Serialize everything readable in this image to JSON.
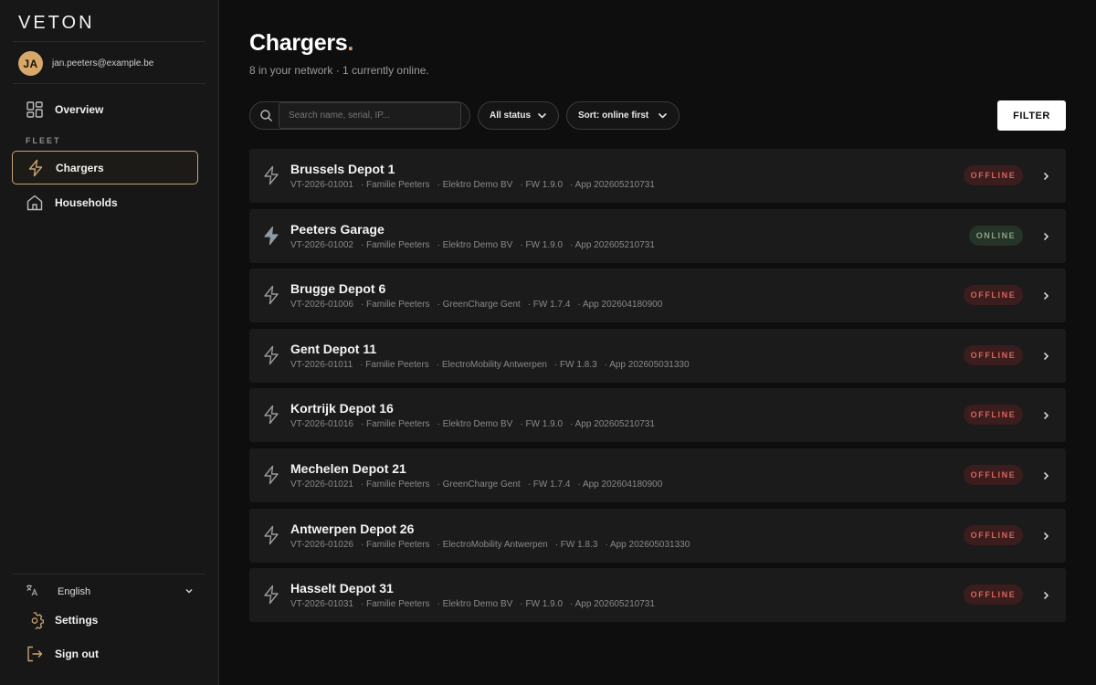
{
  "app": {
    "logo": "VETON"
  },
  "user": {
    "initials": "JA",
    "email": "jan.peeters@example.be"
  },
  "sidebar": {
    "overview_label": "Overview",
    "section_label": "FLEET",
    "chargers_label": "Chargers",
    "households_label": "Households",
    "language": "English",
    "settings_label": "Settings",
    "signout_label": "Sign out"
  },
  "page": {
    "title": "Chargers",
    "title_dot": ".",
    "subtitle": "8 in your network · 1 currently online."
  },
  "toolbar": {
    "search_placeholder": "Search name, serial, IP...",
    "status_filter": "All status",
    "sort": "Sort: online first",
    "filter_button": "FILTER"
  },
  "colors": {
    "accent": "#d9a15c",
    "offline_bg": "#3a1d1c",
    "offline_text": "#d5655d",
    "online_bg": "#253427",
    "online_text": "#8aa08d"
  },
  "chargers": [
    {
      "name": "Brussels Depot 1",
      "serial": "VT-2026-01001",
      "household": "· Familie Peeters",
      "installer": "· Elektro Demo BV",
      "fw": "· FW 1.9.0",
      "app": "· App 202605210731",
      "status": "OFFLINE"
    },
    {
      "name": "Peeters Garage",
      "serial": "VT-2026-01002",
      "household": "· Familie Peeters",
      "installer": "· Elektro Demo BV",
      "fw": "· FW 1.9.0",
      "app": "· App 202605210731",
      "status": "ONLINE"
    },
    {
      "name": "Brugge Depot 6",
      "serial": "VT-2026-01006",
      "household": "· Familie Peeters",
      "installer": "· GreenCharge Gent",
      "fw": "· FW 1.7.4",
      "app": "· App 202604180900",
      "status": "OFFLINE"
    },
    {
      "name": "Gent Depot 11",
      "serial": "VT-2026-01011",
      "household": "· Familie Peeters",
      "installer": "· ElectroMobility Antwerpen",
      "fw": "· FW 1.8.3",
      "app": "· App 202605031330",
      "status": "OFFLINE"
    },
    {
      "name": "Kortrijk Depot 16",
      "serial": "VT-2026-01016",
      "household": "· Familie Peeters",
      "installer": "· Elektro Demo BV",
      "fw": "· FW 1.9.0",
      "app": "· App 202605210731",
      "status": "OFFLINE"
    },
    {
      "name": "Mechelen Depot 21",
      "serial": "VT-2026-01021",
      "household": "· Familie Peeters",
      "installer": "· GreenCharge Gent",
      "fw": "· FW 1.7.4",
      "app": "· App 202604180900",
      "status": "OFFLINE"
    },
    {
      "name": "Antwerpen Depot 26",
      "serial": "VT-2026-01026",
      "household": "· Familie Peeters",
      "installer": "· ElectroMobility Antwerpen",
      "fw": "· FW 1.8.3",
      "app": "· App 202605031330",
      "status": "OFFLINE"
    },
    {
      "name": "Hasselt Depot 31",
      "serial": "VT-2026-01031",
      "household": "· Familie Peeters",
      "installer": "· Elektro Demo BV",
      "fw": "· FW 1.9.0",
      "app": "· App 202605210731",
      "status": "OFFLINE"
    }
  ]
}
